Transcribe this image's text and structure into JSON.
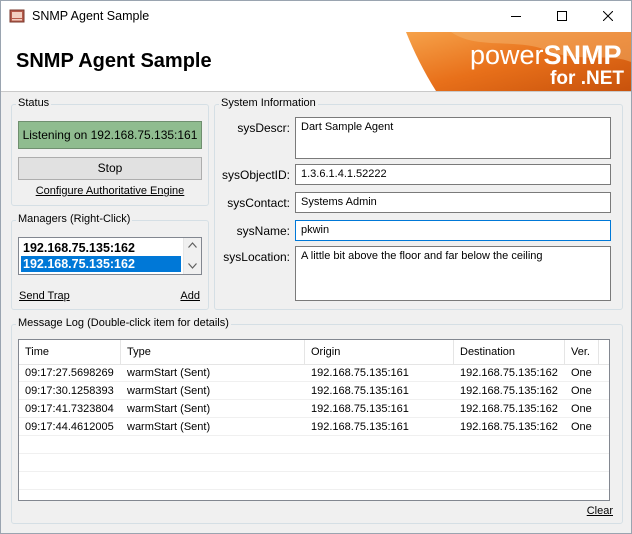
{
  "window": {
    "title": "SNMP Agent Sample"
  },
  "header": {
    "heading": "SNMP Agent Sample",
    "logo_power": "power",
    "logo_snmp": "SNMP",
    "logo_net": "for .NET"
  },
  "status": {
    "group_label": "Status",
    "status_text": "Listening on 192.168.75.135:161",
    "stop_label": "Stop",
    "configure_link": "Configure Authoritative Engine"
  },
  "managers": {
    "group_label": "Managers (Right-Click)",
    "items": [
      "192.168.75.135:162",
      "192.168.75.135:162"
    ],
    "send_trap_label": "Send Trap",
    "add_label": "Add"
  },
  "sysinfo": {
    "group_label": "System Information",
    "fields": [
      {
        "label": "sysDescr:",
        "value": "Dart Sample Agent"
      },
      {
        "label": "sysObjectID:",
        "value": "1.3.6.1.4.1.52222"
      },
      {
        "label": "sysContact:",
        "value": "Systems Admin"
      },
      {
        "label": "sysName:",
        "value": "pkwin"
      },
      {
        "label": "sysLocation:",
        "value": "A little bit above the floor and far below the ceiling"
      }
    ]
  },
  "log": {
    "group_label": "Message Log (Double-click item for details)",
    "columns": [
      "Time",
      "Type",
      "Origin",
      "Destination",
      "Ver."
    ],
    "rows": [
      [
        "09:17:27.5698269",
        "warmStart (Sent)",
        "192.168.75.135:161",
        "192.168.75.135:162",
        "One"
      ],
      [
        "09:17:30.1258393",
        "warmStart (Sent)",
        "192.168.75.135:161",
        "192.168.75.135:162",
        "One"
      ],
      [
        "09:17:41.7323804",
        "warmStart (Sent)",
        "192.168.75.135:161",
        "192.168.75.135:162",
        "One"
      ],
      [
        "09:17:44.4612005",
        "warmStart (Sent)",
        "192.168.75.135:161",
        "192.168.75.135:162",
        "One"
      ]
    ],
    "clear_label": "Clear"
  },
  "colors": {
    "status_green": "#8fbc8f",
    "selection": "#0078d7",
    "logo_orange": "#e8701a"
  },
  "icons": [
    "app-icon",
    "minimize-icon",
    "maximize-icon",
    "close-icon",
    "scroll-up-icon",
    "scroll-down-icon"
  ]
}
